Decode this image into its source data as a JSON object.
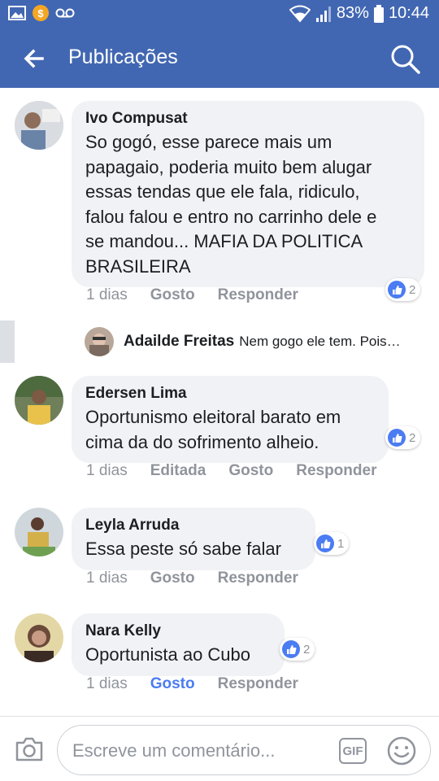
{
  "status_bar": {
    "battery": "83%",
    "time": "10:44"
  },
  "header": {
    "title": "Publicações"
  },
  "comments": [
    {
      "author": "Ivo Compusat",
      "text_lines": [
        "So gogó, esse parece mais um",
        "papagaio, poderia muito bem alugar",
        "essas tendas que ele fala, ridiculo,",
        "falou falou e entro no carrinho dele e",
        "se mandou... MAFIA DA POLITICA",
        "BRASILEIRA"
      ],
      "time": "1 dias",
      "actions": [
        "Gosto",
        "Responder"
      ],
      "likes": "2"
    },
    {
      "author": "Edersen Lima",
      "text_lines": [
        "Oportunismo eleitoral barato em",
        "cima da do sofrimento alheio."
      ],
      "time": "1 dias",
      "actions": [
        "Editada",
        "Gosto",
        "Responder"
      ],
      "likes": "2"
    },
    {
      "author": "Leyla Arruda",
      "text_lines": [
        "Essa peste só sabe falar"
      ],
      "time": "1 dias",
      "actions": [
        "Gosto",
        "Responder"
      ],
      "likes": "1"
    },
    {
      "author": "Nara Kelly",
      "text_lines": [
        "Oportunista ao Cubo"
      ],
      "time": "1 dias",
      "actions": [
        "Gosto",
        "Responder"
      ],
      "likes": "2"
    }
  ],
  "reply_preview": {
    "author": "Adailde Freitas",
    "text": "Nem gogo ele tem. Pois…"
  },
  "composer": {
    "placeholder": "Escreve um comentário...",
    "gif_label": "GIF"
  },
  "colors": {
    "brand": "#4267b2",
    "like_blue": "#4b7cf3",
    "bubble": "#f0f2f5"
  },
  "icons": [
    "image-icon",
    "coin-icon",
    "voicemail-icon",
    "wifi-icon",
    "signal-icon",
    "battery-icon",
    "back-arrow-icon",
    "search-icon",
    "like-icon",
    "camera-icon",
    "gif-icon",
    "smiley-icon"
  ]
}
